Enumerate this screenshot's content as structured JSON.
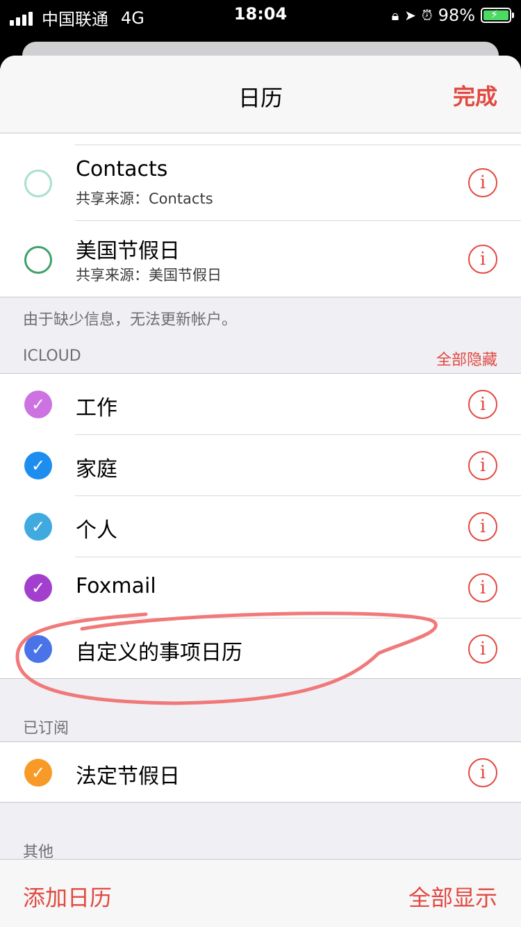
{
  "status_bar": {
    "carrier": "中国联通",
    "network": "4G",
    "time": "18:04",
    "battery": "98%",
    "icons": [
      "orientation-lock-icon",
      "location-icon",
      "alarm-icon",
      "battery-charging-icon"
    ]
  },
  "nav": {
    "title": "日历",
    "done_label": "完成"
  },
  "top_group": {
    "rows": [
      {
        "title": "Contacts",
        "subtitle": "共享来源：Contacts",
        "color": "#a8e0cc",
        "checked": false
      },
      {
        "title": "美国节假日",
        "subtitle": "共享来源：美国节假日",
        "color": "#3ea06a",
        "checked": false
      }
    ]
  },
  "notice": "由于缺少信息，无法更新帐户。",
  "icloud": {
    "header": "ICLOUD",
    "action": "全部隐藏",
    "rows": [
      {
        "title": "工作",
        "color": "#cc73e1",
        "checked": true
      },
      {
        "title": "家庭",
        "color": "#1d8ef0",
        "checked": true
      },
      {
        "title": "个人",
        "color": "#3fa9e0",
        "checked": true
      },
      {
        "title": "Foxmail",
        "color": "#a23fcf",
        "checked": true
      },
      {
        "title": "自定义的事项日历",
        "color": "#4a73e8",
        "checked": true
      }
    ]
  },
  "subscribed": {
    "header": "已订阅",
    "rows": [
      {
        "title": "法定节假日",
        "color": "#f79a27",
        "checked": true
      }
    ]
  },
  "other": {
    "header": "其他"
  },
  "toolbar": {
    "add_label": "添加日历",
    "show_all_label": "全部显示"
  },
  "colors": {
    "accent": "#e2483f",
    "annotation": "#f06a6a"
  }
}
